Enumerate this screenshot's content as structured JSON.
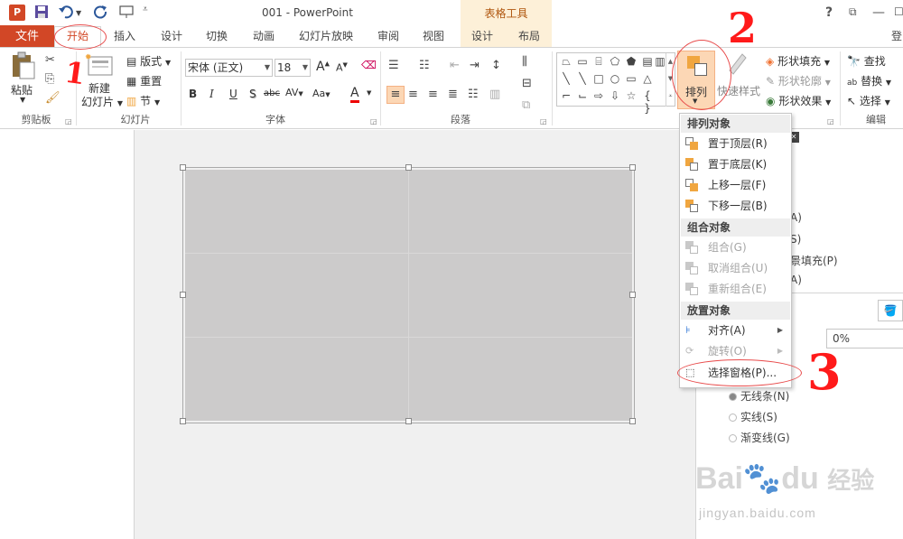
{
  "titlebar": {
    "logo_text": "P",
    "doc_title": "001 - PowerPoint",
    "context_tool": "表格工具",
    "help": "?",
    "controls": [
      "?",
      "⧉",
      "—",
      "☐"
    ]
  },
  "tabs": {
    "file": "文件",
    "home": "开始",
    "insert": "插入",
    "design": "设计",
    "transitions": "切换",
    "animations": "动画",
    "slideshow": "幻灯片放映",
    "review": "审阅",
    "view": "视图",
    "ctx_design": "设计",
    "ctx_layout": "布局",
    "login": "登"
  },
  "ribbon": {
    "clipboard": {
      "paste": "粘贴",
      "label": "剪贴板"
    },
    "slides": {
      "new_slide": "新建\n幻灯片",
      "new_slide_1": "新建",
      "new_slide_2": "幻灯片",
      "layout": "版式",
      "reset": "重置",
      "section": "节",
      "label": "幻灯片"
    },
    "font": {
      "font_name": "宋体 (正文)",
      "font_size": "18",
      "label": "字体",
      "bold": "B",
      "italic": "I",
      "underline": "U",
      "shadow": "S",
      "strike": "abc",
      "spacing": "AV",
      "case": "Aa",
      "color": "A",
      "grow": "A",
      "shrink": "A"
    },
    "paragraph": {
      "label": "段落"
    },
    "drawing": {
      "arrange": "排列",
      "quick_styles": "快速样式",
      "shape_fill": "形状填充",
      "shape_outline": "形状轮廓",
      "shape_effects": "形状效果"
    },
    "editing": {
      "find": "查找",
      "replace": "替换",
      "select": "选择",
      "label": "编辑"
    }
  },
  "arrange_menu": {
    "section_order": "排列对象",
    "bring_front": "置于顶层(R)",
    "send_back": "置于底层(K)",
    "bring_forward": "上移一层(F)",
    "send_backward": "下移一层(B)",
    "section_group": "组合对象",
    "group": "组合(G)",
    "ungroup": "取消组合(U)",
    "regroup": "重新组合(E)",
    "section_position": "放置对象",
    "align": "对齐(A)",
    "rotate": "旋转(O)",
    "selection_pane": "选择窗格(P)..."
  },
  "format_pane": {
    "partial_1": "A)",
    "partial_2": "S)",
    "partial_3": "景填充(P)",
    "partial_4": "A)",
    "percent": "0%",
    "no_line": "无线条(N)",
    "solid_line": "实线(S)",
    "gradient_line": "渐变线(G)"
  },
  "annotations": {
    "one": "1",
    "two": "2",
    "three": "3"
  },
  "watermark": {
    "brand": "Bai",
    "brand2": "du",
    "cn": "经验",
    "url": "jingyan.baidu.com"
  }
}
